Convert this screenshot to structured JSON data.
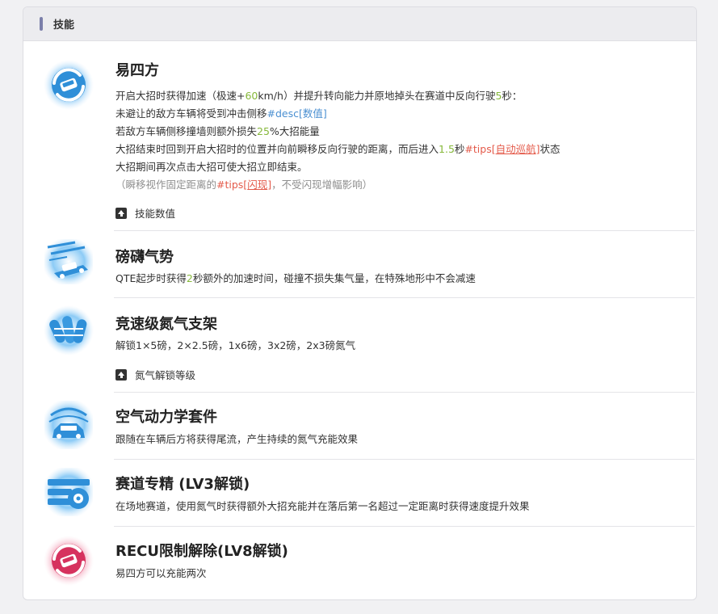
{
  "card": {
    "title": "技能"
  },
  "colors": {
    "accent_green": "#86b83a",
    "accent_blue": "#4a8fd1",
    "accent_red": "#e45a4a",
    "header_bar": "#7b7faa"
  },
  "skills": [
    {
      "name": "易四方",
      "icon": "drift-car-swirl-icon",
      "desc": {
        "l1a": "开启大招时获得加速（极速+",
        "l1b": "60",
        "l1c": "km/h）并提升转向能力并原地掉头在赛道中反向行驶",
        "l1d": "5",
        "l1e": "秒：",
        "l2a": "未避让的敌方车辆将受到冲击侧移",
        "l2b": "#desc[数值]",
        "l3a": "若敌方车辆侧移撞墙则额外损失",
        "l3b": "25",
        "l3c": "%大招能量",
        "l4a": "大招结束时回到开启大招时的位置并向前瞬移反向行驶的距离，而后进入",
        "l4b": "1.5",
        "l4c": "秒",
        "l4d": "#tips[",
        "l4e": "自动巡航",
        "l4f": "]",
        "l4g": "状态",
        "l5": "大招期间再次点击大招可使大招立即结束。",
        "l6a": "（瞬移视作固定距离的",
        "l6b": "#tips[",
        "l6c": "闪现",
        "l6d": "]",
        "l6e": "，不受闪现增幅影响）"
      },
      "expand_label": "技能数值"
    },
    {
      "name": "磅礴气势",
      "icon": "car-speed-lines-icon",
      "desc": {
        "a": "QTE起步时获得",
        "b": "2",
        "c": "秒额外的加速时间，碰撞不损失集气量，在特殊地形中不会减速"
      }
    },
    {
      "name": "竞速级氮气支架",
      "icon": "nitro-tanks-icon",
      "desc": {
        "a": "解锁1×5磅，2×2.5磅，1x6磅，3x2磅，2x3磅氮气"
      },
      "expand_label": "氮气解锁等级"
    },
    {
      "name": "空气动力学套件",
      "icon": "aero-car-icon",
      "desc": {
        "a": "跟随在车辆后方将获得尾流，产生持续的氮气充能效果"
      }
    },
    {
      "name": "赛道专精 (LV3解锁)",
      "icon": "tire-track-icon",
      "desc": {
        "a": "在场地赛道，使用氮气时获得额外大招充能并在落后第一名超过一定距离时获得速度提升效果"
      }
    },
    {
      "name": "RECU限制解除(LV8解锁)",
      "icon": "drift-car-swirl-red-icon",
      "desc": {
        "a": "易四方可以充能两次"
      }
    }
  ]
}
